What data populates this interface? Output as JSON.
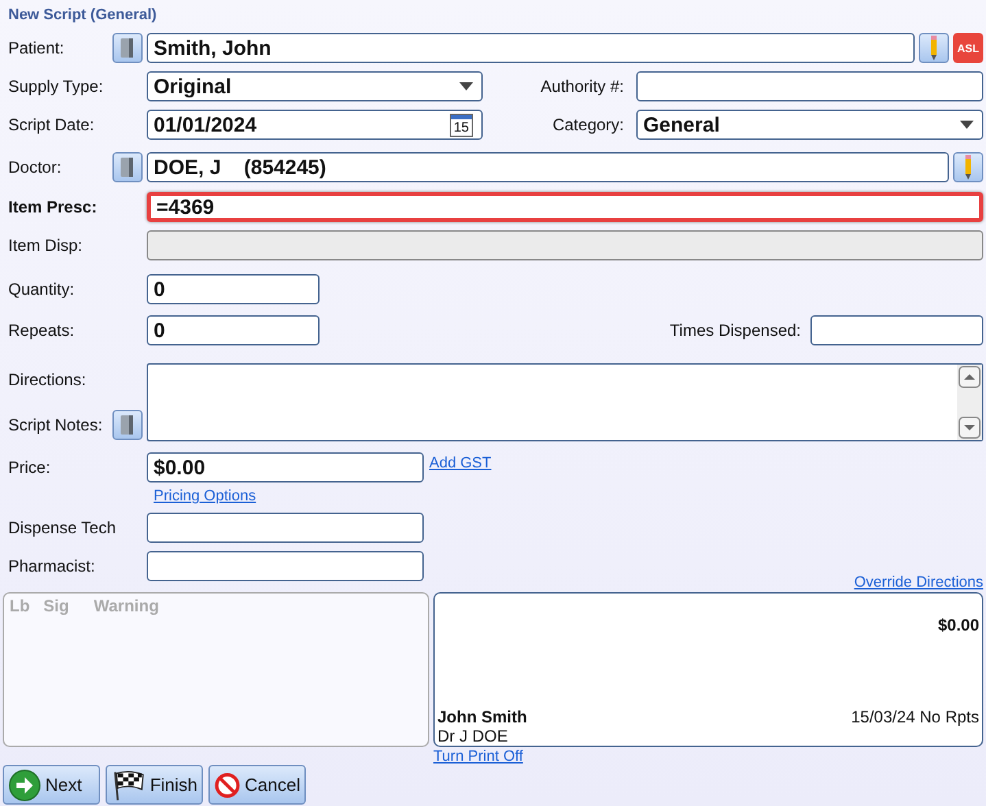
{
  "window": {
    "title": "New Script (General)"
  },
  "patient": {
    "label": "Patient:",
    "value": "Smith, John",
    "badge": "ASL"
  },
  "supply_type": {
    "label": "Supply Type:",
    "value": "Original"
  },
  "authority": {
    "label": "Authority #:"
  },
  "script_date": {
    "label": "Script Date:",
    "value": "01/01/2024",
    "calendar_day": "15"
  },
  "category": {
    "label": "Category:",
    "value": "General"
  },
  "doctor": {
    "label": "Doctor:",
    "value": "DOE, J    (854245)"
  },
  "item_presc": {
    "label": "Item Presc:",
    "value": "=4369",
    "focused": true
  },
  "item_disp": {
    "label": "Item Disp:",
    "disabled": true
  },
  "quantity": {
    "label": "Quantity:",
    "value": "0"
  },
  "repeats": {
    "label": "Repeats:",
    "value": "0"
  },
  "times_dispensed": {
    "label": "Times Dispensed:"
  },
  "directions": {
    "label": "Directions:"
  },
  "script_notes": {
    "label": "Script Notes:"
  },
  "price": {
    "label": "Price:",
    "value": "$0.00",
    "link": "Add GST"
  },
  "pricing_options": "Pricing Options",
  "dispense_tech": {
    "label": "Dispense Tech"
  },
  "pharmacist": {
    "label": "Pharmacist:"
  },
  "override_directions": "Override Directions",
  "warnings_panel": {
    "columns": [
      "Lb",
      "Sig",
      "Warning"
    ]
  },
  "label_preview": {
    "price": "$0.00",
    "patient": "John Smith",
    "date_repeats": "15/03/24 No Rpts",
    "doctor": "Dr J DOE"
  },
  "turn_print_off": "Turn Print Off",
  "buttons": [
    {
      "label": "Next",
      "kind": "next"
    },
    {
      "label": "Finish",
      "kind": "finish"
    },
    {
      "label": "Cancel",
      "kind": "cancel"
    }
  ]
}
